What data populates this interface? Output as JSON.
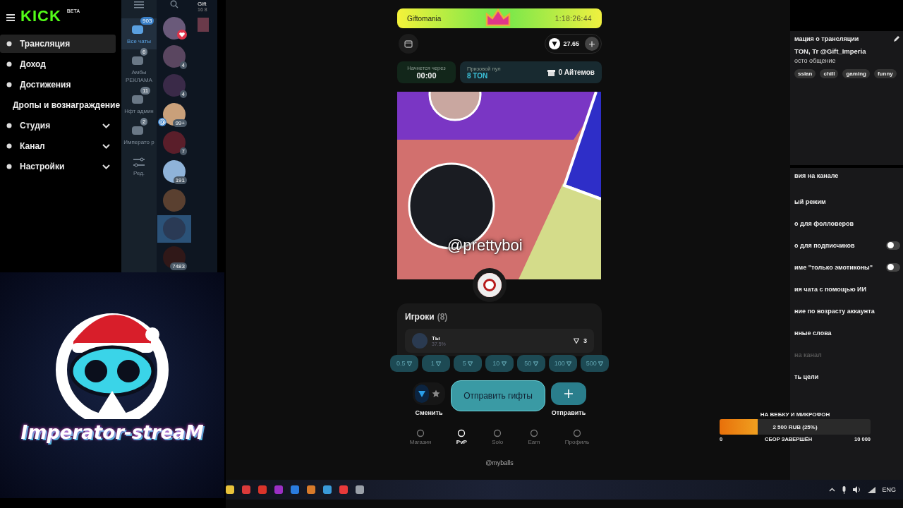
{
  "sidebar": {
    "logo": "KICK",
    "logo_badge": "BETA",
    "items": [
      {
        "label": "Трансляция",
        "kind": "main",
        "selected": true,
        "expandable": false
      },
      {
        "label": "Доход",
        "kind": "main",
        "selected": false,
        "expandable": false
      },
      {
        "label": "Достижения",
        "kind": "main",
        "selected": false,
        "expandable": false
      },
      {
        "label": "Дропы и вознаграждение",
        "kind": "sub",
        "selected": false,
        "expandable": false
      },
      {
        "label": "Студия",
        "kind": "main",
        "selected": false,
        "expandable": true
      },
      {
        "label": "Канал",
        "kind": "main",
        "selected": false,
        "expandable": true
      },
      {
        "label": "Настройки",
        "kind": "main",
        "selected": false,
        "expandable": true
      }
    ]
  },
  "chat_folders": [
    {
      "label": "Все чаты",
      "badge": "903",
      "selected": true
    },
    {
      "label": "Амбы РЕКЛАМА",
      "badge": "6",
      "selected": false
    },
    {
      "label": "Нфт админ",
      "badge": "11",
      "selected": false
    },
    {
      "label": "Императо р",
      "badge": "2",
      "selected": false
    },
    {
      "label": "Ред.",
      "kind": "edit",
      "selected": false
    }
  ],
  "chats": [
    {
      "heart": true,
      "mention": false,
      "selected": false
    },
    {
      "badge": "4",
      "heart": false,
      "mention": false,
      "selected": false
    },
    {
      "badge": "4",
      "heart": false,
      "mention": false,
      "selected": false
    },
    {
      "badge": "99+",
      "heart": false,
      "mention": true,
      "selected": false
    },
    {
      "badge": "7",
      "heart": false,
      "mention": false,
      "selected": false
    },
    {
      "badge": "191",
      "heart": false,
      "mention": false,
      "selected": false
    },
    {
      "heart": false,
      "mention": false,
      "selected": false
    },
    {
      "heart": false,
      "mention": false,
      "selected": true
    },
    {
      "badge": "7483",
      "heart": false,
      "mention": false,
      "selected": false
    }
  ],
  "chat_header": {
    "title": "Gift",
    "subtitle": "16 8"
  },
  "stream_logo": {
    "text": "Imperator-streaM"
  },
  "game": {
    "banner": {
      "title": "Giftomania",
      "timer": "1:18:26:44"
    },
    "balance": "27.65",
    "countdown": {
      "label": "Начнется через",
      "value": "00:00"
    },
    "prize": {
      "label": "Призовой пул",
      "value": "8 TON",
      "items": "0 Айтемов"
    },
    "winner": "@prettyboi",
    "players": {
      "title": "Игроки",
      "count": "(8)",
      "rows": [
        {
          "name": "Ты",
          "chance": "37.5%",
          "amount": "3"
        }
      ]
    },
    "amounts": [
      "0.5",
      "1",
      "5",
      "10",
      "50",
      "100",
      "500"
    ],
    "currencies": [
      {
        "kind": "ton",
        "selected": true
      },
      {
        "kind": "star",
        "selected": false
      }
    ],
    "switch_label": "Сменить",
    "send_gifts": "Отправить гифты",
    "send_label": "Отправить",
    "nav": [
      {
        "label": "Магазин",
        "selected": false
      },
      {
        "label": "PvP",
        "selected": true
      },
      {
        "label": "Solo",
        "selected": false
      },
      {
        "label": "Earn",
        "selected": false
      },
      {
        "label": "Профиль",
        "selected": false
      }
    ],
    "footer": "@myballs"
  },
  "right_panel": {
    "info": {
      "title": "мация о трансляции",
      "line": "TON, Tr @Gift_Imperia",
      "category": "осто общение",
      "tags": [
        "ssian",
        "chill",
        "gaming",
        "funny"
      ]
    },
    "settings": {
      "title": "вия на канале",
      "rows": [
        {
          "label": "ый режим",
          "kind": "plain",
          "disabled": false
        },
        {
          "label": "о для фолловеров",
          "kind": "plain",
          "disabled": false
        },
        {
          "label": "о для подписчиков",
          "kind": "toggle",
          "on": false,
          "disabled": false
        },
        {
          "label": "име \"только эмотиконы\"",
          "kind": "toggle",
          "on": false,
          "disabled": false
        },
        {
          "label": "ия чата с помощью ИИ",
          "kind": "plain",
          "disabled": false
        },
        {
          "label": "ние по возрасту аккаунта",
          "kind": "plain",
          "disabled": false
        },
        {
          "label": "нные слова",
          "kind": "plain",
          "disabled": false
        },
        {
          "label": "на канал",
          "kind": "plain",
          "disabled": true
        },
        {
          "label": "ть цели",
          "kind": "plain",
          "disabled": false
        }
      ]
    }
  },
  "goal": {
    "title": "НА ВЕБКУ И МИКРОФОН",
    "level": 0.25,
    "reading": "2 500 RUB (25%)",
    "min": "0",
    "status": "СБОР ЗАВЕРШЁН",
    "max": "10 000"
  },
  "taskbar": {
    "language": "ENG"
  }
}
